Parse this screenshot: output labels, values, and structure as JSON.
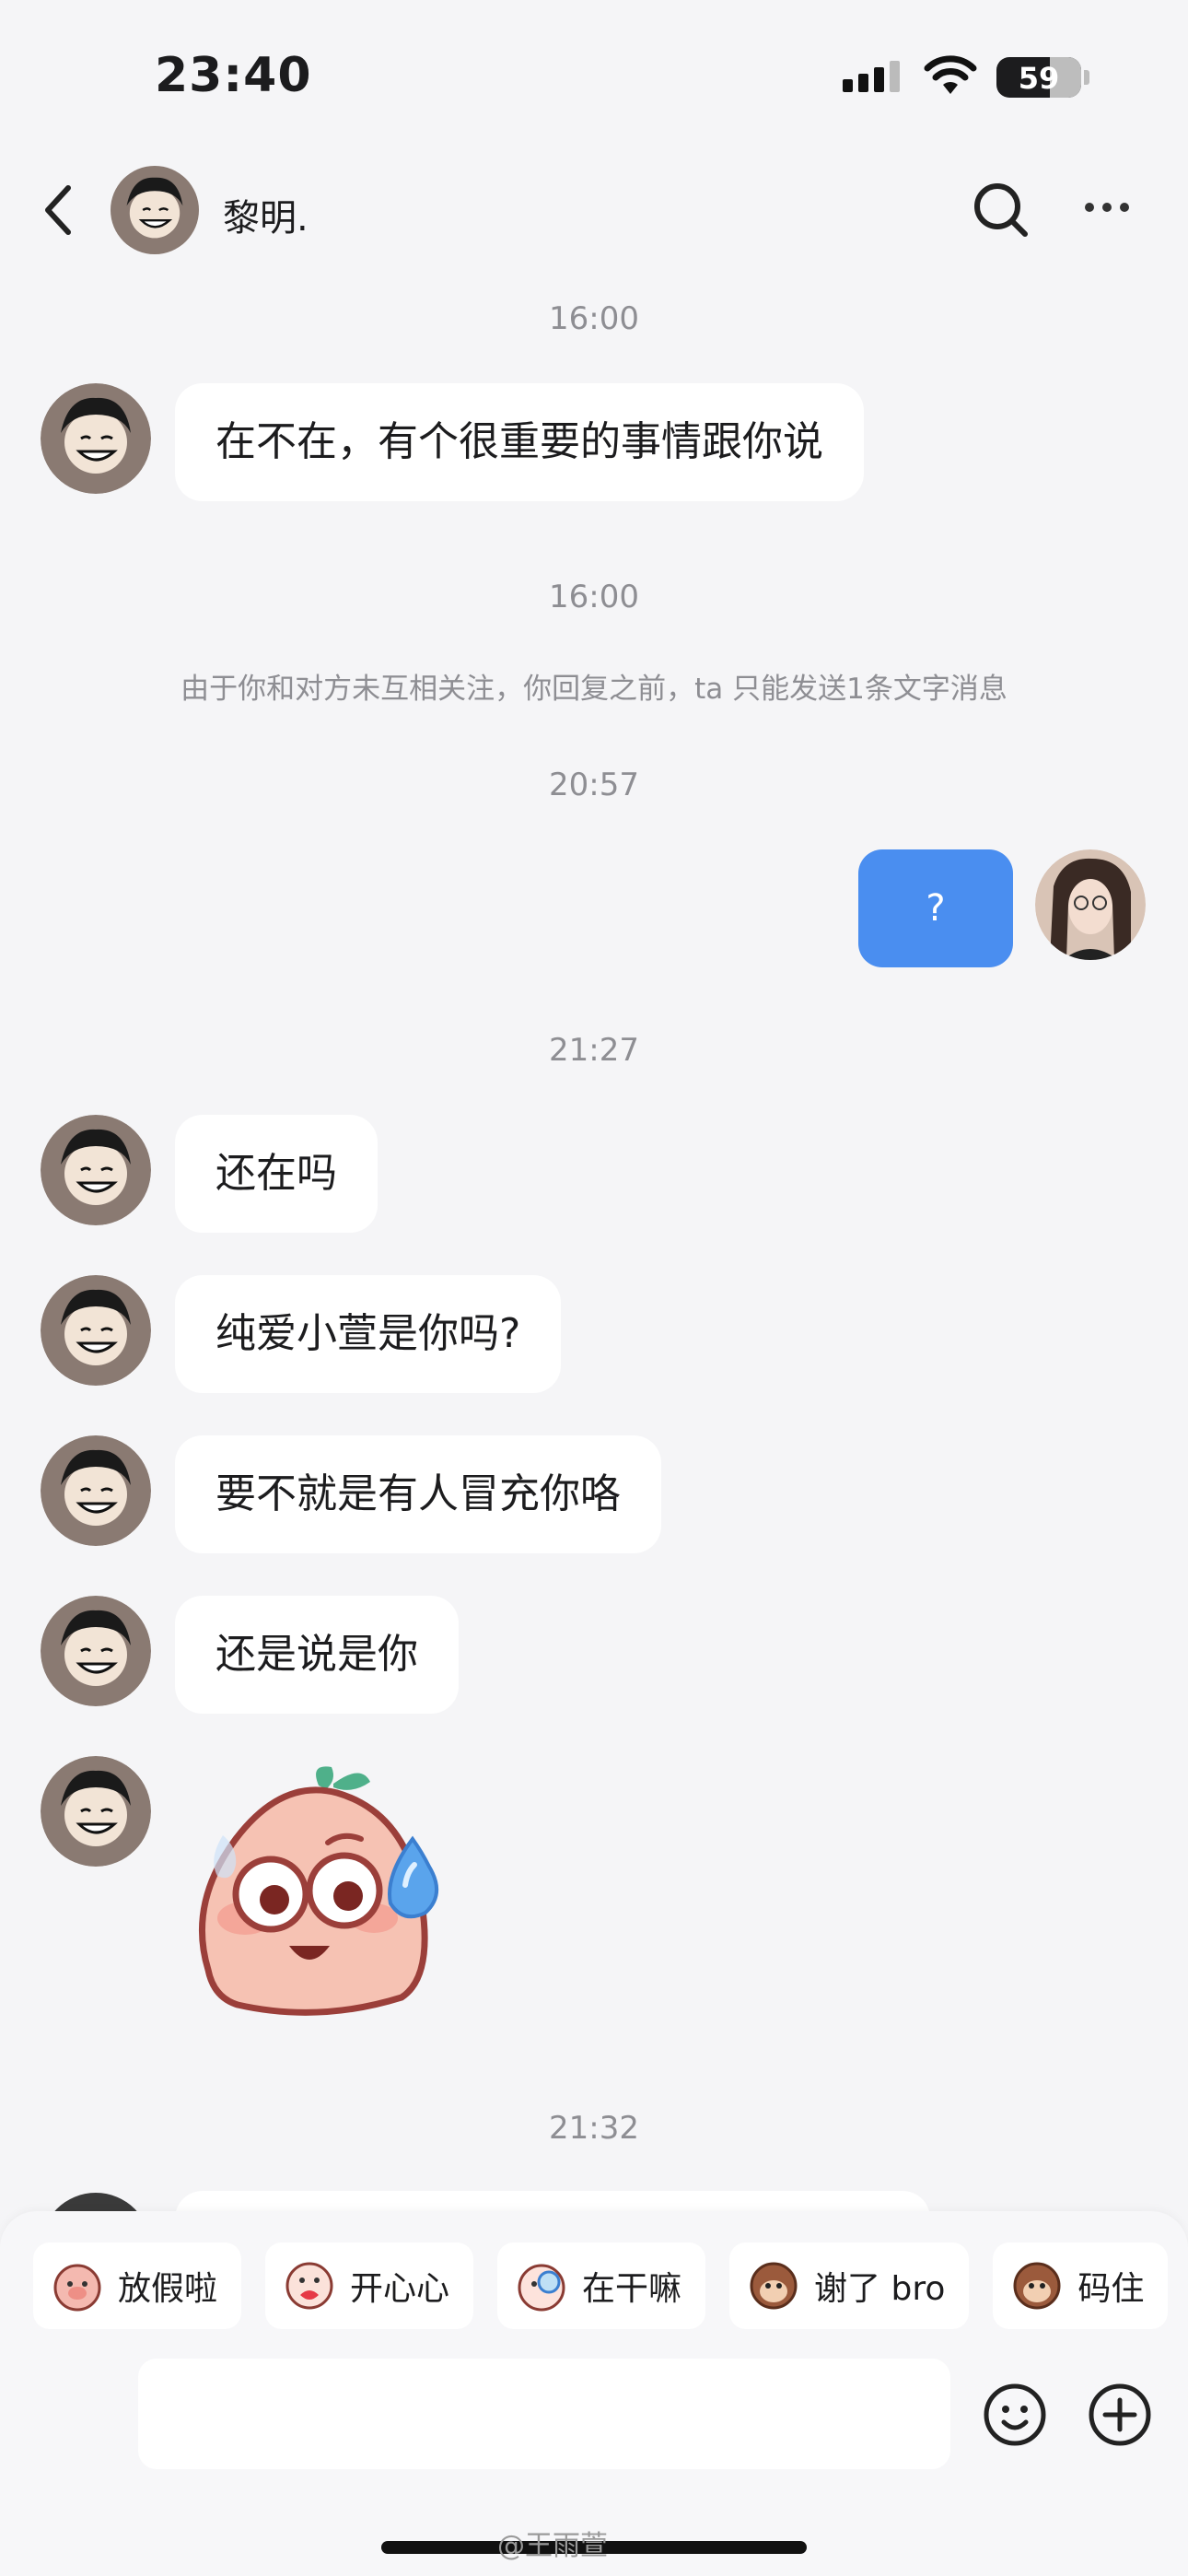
{
  "status_bar": {
    "time": "23:40",
    "battery": "59"
  },
  "header": {
    "contact_name": "黎明."
  },
  "conversation": {
    "stamp_1": "16:00",
    "msg_1": "在不在，有个很重要的事情跟你说",
    "stamp_2": "16:00",
    "notice": "由于你和对方未互相关注，你回复之前，ta 只能发送1条文字消息",
    "stamp_3": "20:57",
    "msg_out_1": "?",
    "stamp_4": "21:27",
    "msg_2": "还在吗",
    "msg_3": "纯爱小萱是你吗?",
    "msg_4": "要不就是有人冒充你咯",
    "msg_5": "还是说是你",
    "stamp_5": "21:32"
  },
  "quick_replies": [
    "放假啦",
    "开心心",
    "在干嘛",
    "谢了 bro",
    "码住"
  ],
  "watermark": "@王雨萱",
  "colors": {
    "sent_bubble": "#4a8ef0",
    "background": "#f5f5f7"
  }
}
